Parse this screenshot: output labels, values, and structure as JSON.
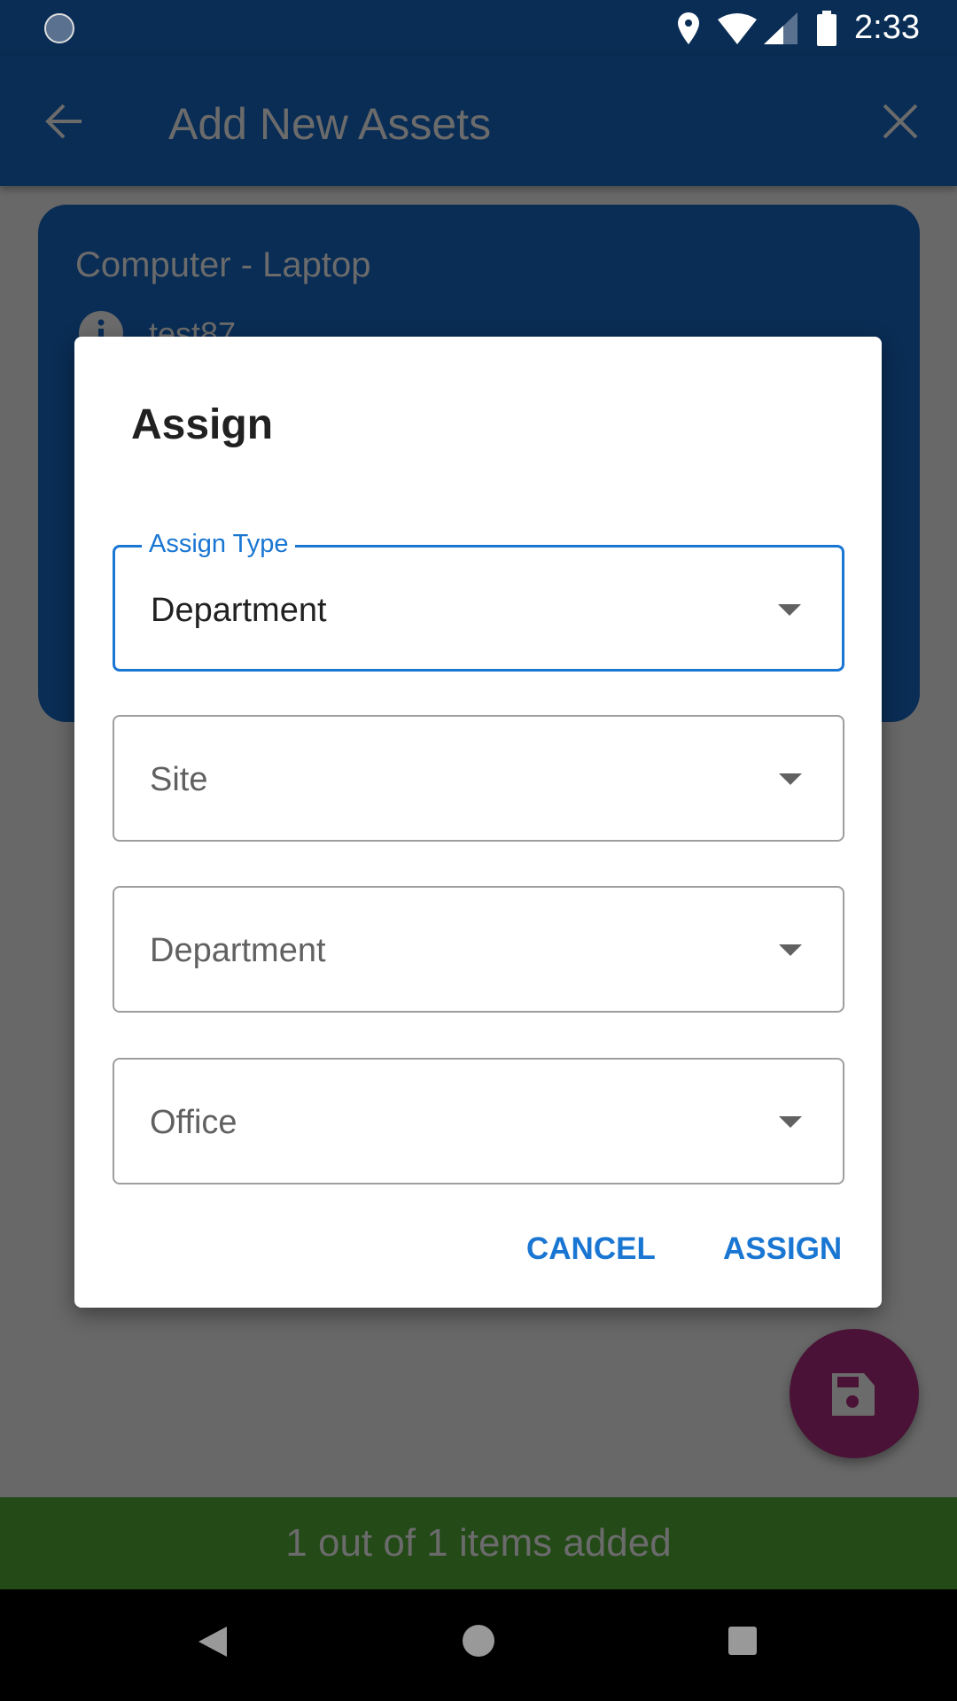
{
  "status_bar": {
    "time": "2:33",
    "icons": [
      "sync-icon",
      "location-icon",
      "wifi-icon",
      "signal-icon",
      "battery-icon"
    ]
  },
  "app_bar": {
    "title": "Add New Assets",
    "back_icon": "arrow-back-icon",
    "close_icon": "close-icon"
  },
  "card": {
    "title": "Computer - Laptop",
    "subtitle": "test87",
    "icon": "info-icon"
  },
  "dialog": {
    "title": "Assign",
    "fields": [
      {
        "label": "Assign Type",
        "value": "Department",
        "focused": true
      },
      {
        "placeholder": "Site"
      },
      {
        "placeholder": "Department"
      },
      {
        "placeholder": "Office"
      }
    ],
    "cancel": "CANCEL",
    "assign": "ASSIGN"
  },
  "fab": {
    "icon": "save-icon"
  },
  "banner": {
    "text": "1 out of 1 items added"
  },
  "colors": {
    "primary": "#0a2d55",
    "accent": "#1976d2",
    "fab": "#4a1236",
    "banner": "#234a17"
  }
}
